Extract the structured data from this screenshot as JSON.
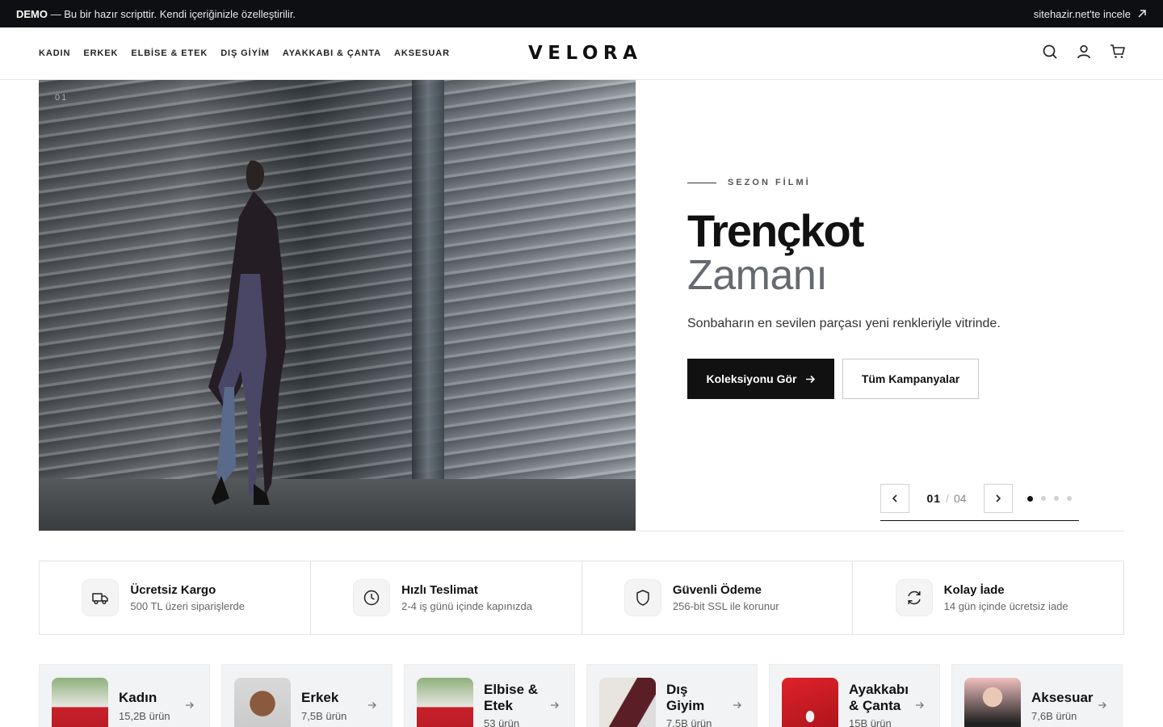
{
  "demo_bar": {
    "badge": "DEMO",
    "message": " — Bu bir hazır scripttir. Kendi içeriğinizle özelleştirilir.",
    "link_label": "sitehazir.net'te incele"
  },
  "header": {
    "nav": [
      "KADIN",
      "ERKEK",
      "ELBİSE & ETEK",
      "DIŞ GİYİM",
      "AYAKKABI & ÇANTA",
      "AKSESUAR"
    ],
    "logo": "VELORA",
    "icons": [
      "search-icon",
      "user-icon",
      "cart-icon"
    ]
  },
  "hero": {
    "slide_index": "01",
    "eyebrow": "SEZON FİLMİ",
    "title_line1": "Trençkot",
    "title_line2": "Zamanı",
    "description": "Sonbaharın en sevilen parçası yeni renkleriyle vitrinde.",
    "primary_button": "Koleksiyonu Gör",
    "secondary_button": "Tüm Kampanyalar",
    "pager": {
      "current": "01",
      "separator": "/",
      "total": "04",
      "dots": 4,
      "active_dot": 1
    }
  },
  "features": [
    {
      "icon": "truck-icon",
      "title": "Ücretsiz Kargo",
      "subtitle": "500 TL üzeri siparişlerde"
    },
    {
      "icon": "clock-icon",
      "title": "Hızlı Teslimat",
      "subtitle": "2-4 iş günü içinde kapınızda"
    },
    {
      "icon": "shield-icon",
      "title": "Güvenli Ödeme",
      "subtitle": "256-bit SSL ile korunur"
    },
    {
      "icon": "refresh-icon",
      "title": "Kolay İade",
      "subtitle": "14 gün içinde ücretsiz iade"
    }
  ],
  "categories": [
    {
      "name": "Kadın",
      "count": "15,2B ürün"
    },
    {
      "name": "Erkek",
      "count": "7,5B ürün"
    },
    {
      "name": "Elbise & Etek",
      "count": "53 ürün"
    },
    {
      "name": "Dış Giyim",
      "count": "7,5B ürün"
    },
    {
      "name": "Ayakkabı & Çanta",
      "count": "15B ürün"
    },
    {
      "name": "Aksesuar",
      "count": "7,6B ürün"
    }
  ]
}
